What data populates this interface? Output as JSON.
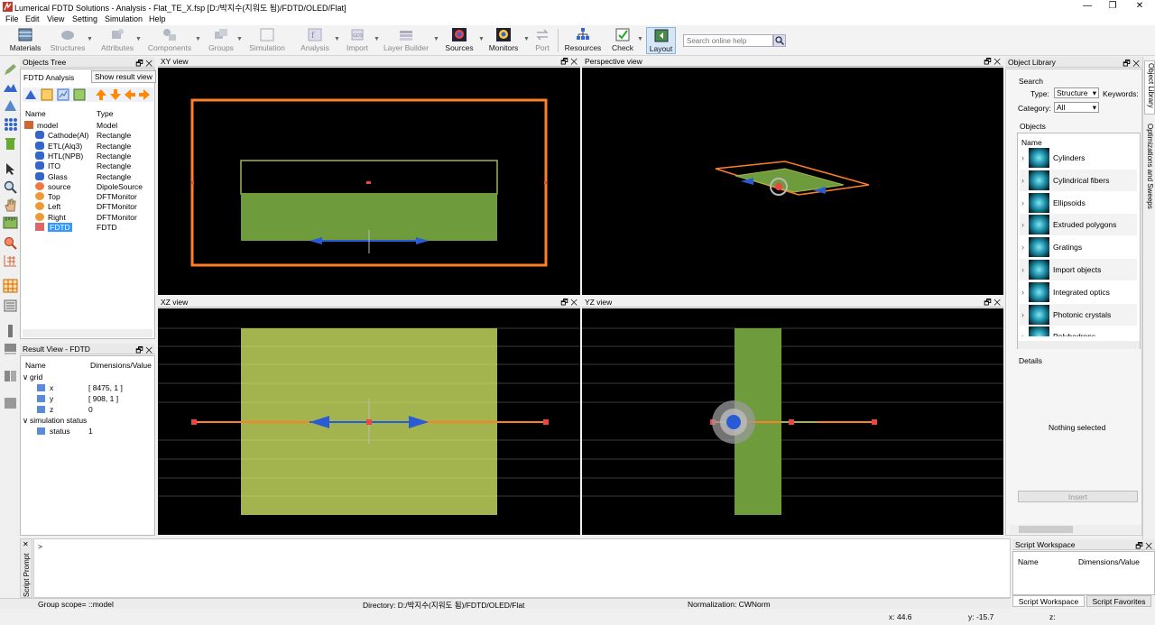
{
  "title": "Lumerical FDTD Solutions - Analysis - Flat_TE_X.fsp [D:/박지수(지워도 됨)/FDTD/OLED/Flat]",
  "menu": [
    "File",
    "Edit",
    "View",
    "Setting",
    "Simulation",
    "Help"
  ],
  "toolbar": {
    "materials": "Materials",
    "structures": "Structures",
    "attributes": "Attributes",
    "components": "Components",
    "groups": "Groups",
    "simulation": "Simulation",
    "analysis": "Analysis",
    "import": "Import",
    "layer_builder": "Layer Builder",
    "sources": "Sources",
    "monitors": "Monitors",
    "port": "Port",
    "resources": "Resources",
    "check": "Check",
    "layout": "Layout",
    "search_placeholder": "Search online help"
  },
  "objects_tree": {
    "title": "Objects Tree",
    "analysis_label": "FDTD Analysis",
    "show_result_btn": "Show result view",
    "col_name": "Name",
    "col_type": "Type",
    "rows": [
      {
        "name": "model",
        "type": "Model"
      },
      {
        "name": "Cathode(Al)",
        "type": "Rectangle"
      },
      {
        "name": "ETL(Alq3)",
        "type": "Rectangle"
      },
      {
        "name": "HTL(NPB)",
        "type": "Rectangle"
      },
      {
        "name": "ITO",
        "type": "Rectangle"
      },
      {
        "name": "Glass",
        "type": "Rectangle"
      },
      {
        "name": "source",
        "type": "DipoleSource"
      },
      {
        "name": "Top",
        "type": "DFTMonitor"
      },
      {
        "name": "Left",
        "type": "DFTMonitor"
      },
      {
        "name": "Right",
        "type": "DFTMonitor"
      },
      {
        "name": "FDTD",
        "type": "FDTD"
      }
    ]
  },
  "result_view": {
    "title": "Result View - FDTD",
    "col_name": "Name",
    "col_value": "Dimensions/Value",
    "rows": [
      {
        "name": "grid",
        "value": ""
      },
      {
        "name": "x",
        "value": "[ 8475, 1 ]"
      },
      {
        "name": "y",
        "value": "[ 908, 1 ]"
      },
      {
        "name": "z",
        "value": "0"
      },
      {
        "name": "simulation status",
        "value": ""
      },
      {
        "name": "status",
        "value": "1"
      }
    ]
  },
  "views": {
    "xy": "XY view",
    "perspective": "Perspective view",
    "xz": "XZ view",
    "yz": "YZ view"
  },
  "object_library": {
    "title": "Object Library",
    "search_label": "Search",
    "type_label": "Type:",
    "type_value": "Structure",
    "keywords_label": "Keywords:",
    "category_label": "Category:",
    "category_value": "All",
    "objects_label": "Objects",
    "col_name": "Name",
    "items": [
      "Cylinders",
      "Cylindrical fibers",
      "Ellipsoids",
      "Extruded polygons",
      "Gratings",
      "Import objects",
      "Integrated optics",
      "Photonic crystals",
      "Polyhedrons"
    ],
    "details_label": "Details",
    "nothing_selected": "Nothing selected",
    "insert_btn": "Insert"
  },
  "side_tabs": {
    "library": "Object Library",
    "optim": "Optimizations and Sweeps"
  },
  "script_prompt": {
    "title": "Script Prompt",
    "prompt": ">"
  },
  "script_workspace": {
    "title": "Script Workspace",
    "col_name": "Name",
    "col_value": "Dimensions/Value",
    "tab1": "Script Workspace",
    "tab2": "Script Favorites"
  },
  "status": {
    "group_scope": "Group scope= ::model",
    "directory": "Directory: D:/박지수(지워도 됨)/FDTD/OLED/Flat",
    "normalization": "Normalization: CWNorm",
    "x": "x: 44.6",
    "y": "y: -15.7",
    "z": "z:"
  },
  "colors": {
    "fdtd_orange": "#ff7f27",
    "layer_green": "#6e9c3c",
    "layer_olive": "#a3b34e",
    "source_blue": "#2a5bd7"
  }
}
